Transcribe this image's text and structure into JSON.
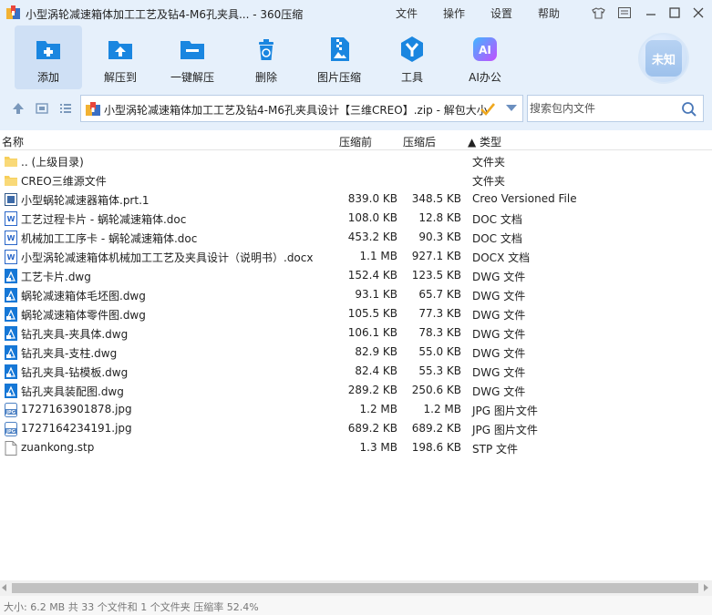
{
  "window": {
    "title": "小型涡轮减速箱体加工工艺及钻4-M6孔夹具... - 360压缩",
    "menu": [
      "文件",
      "操作",
      "设置",
      "帮助"
    ]
  },
  "toolbar": [
    {
      "label": "添加",
      "icon": "add-icon"
    },
    {
      "label": "解压到",
      "icon": "extract-to-icon"
    },
    {
      "label": "一键解压",
      "icon": "one-click-extract-icon"
    },
    {
      "label": "删除",
      "icon": "delete-icon"
    },
    {
      "label": "图片压缩",
      "icon": "image-compress-icon"
    },
    {
      "label": "工具",
      "icon": "tools-icon"
    },
    {
      "label": "AI办公",
      "icon": "ai-office-icon"
    }
  ],
  "badge": {
    "label": "未知"
  },
  "address": {
    "path": "小型涡轮减速箱体加工工艺及钻4-M6孔夹具设计【三维CREO】.zip - 解包大小"
  },
  "search": {
    "placeholder": "搜索包内文件"
  },
  "columns": {
    "name": "名称",
    "size": "压缩前",
    "packed": "压缩后",
    "type": "▲ 类型"
  },
  "files": [
    {
      "name": ".. (上级目录)",
      "size": "",
      "packed": "",
      "type": "文件夹",
      "icon": "folder-icon"
    },
    {
      "name": "CREO三维源文件",
      "size": "",
      "packed": "",
      "type": "文件夹",
      "icon": "folder-icon"
    },
    {
      "name": "小型蜗轮减速器箱体.prt.1",
      "size": "839.0 KB",
      "packed": "348.5 KB",
      "type": "Creo Versioned File",
      "icon": "creo-file-icon"
    },
    {
      "name": "工艺过程卡片 - 蜗轮减速箱体.doc",
      "size": "108.0 KB",
      "packed": "12.8 KB",
      "type": "DOC 文档",
      "icon": "word-doc-icon"
    },
    {
      "name": "机械加工工序卡 - 蜗轮减速箱体.doc",
      "size": "453.2 KB",
      "packed": "90.3 KB",
      "type": "DOC 文档",
      "icon": "word-doc-icon"
    },
    {
      "name": "小型涡轮减速箱体机械加工工艺及夹具设计（说明书）.docx",
      "size": "1.1 MB",
      "packed": "927.1 KB",
      "type": "DOCX 文档",
      "icon": "word-doc-icon"
    },
    {
      "name": "工艺卡片.dwg",
      "size": "152.4 KB",
      "packed": "123.5 KB",
      "type": "DWG 文件",
      "icon": "dwg-file-icon"
    },
    {
      "name": "蜗轮减速箱体毛坯图.dwg",
      "size": "93.1 KB",
      "packed": "65.7 KB",
      "type": "DWG 文件",
      "icon": "dwg-file-icon"
    },
    {
      "name": "蜗轮减速箱体零件图.dwg",
      "size": "105.5 KB",
      "packed": "77.3 KB",
      "type": "DWG 文件",
      "icon": "dwg-file-icon"
    },
    {
      "name": "钻孔夹具-夹具体.dwg",
      "size": "106.1 KB",
      "packed": "78.3 KB",
      "type": "DWG 文件",
      "icon": "dwg-file-icon"
    },
    {
      "name": "钻孔夹具-支柱.dwg",
      "size": "82.9 KB",
      "packed": "55.0 KB",
      "type": "DWG 文件",
      "icon": "dwg-file-icon"
    },
    {
      "name": "钻孔夹具-钻模板.dwg",
      "size": "82.4 KB",
      "packed": "55.3 KB",
      "type": "DWG 文件",
      "icon": "dwg-file-icon"
    },
    {
      "name": "钻孔夹具装配图.dwg",
      "size": "289.2 KB",
      "packed": "250.6 KB",
      "type": "DWG 文件",
      "icon": "dwg-file-icon"
    },
    {
      "name": "1727163901878.jpg",
      "size": "1.2 MB",
      "packed": "1.2 MB",
      "type": "JPG 图片文件",
      "icon": "jpg-file-icon"
    },
    {
      "name": "1727164234191.jpg",
      "size": "689.2 KB",
      "packed": "689.2 KB",
      "type": "JPG 图片文件",
      "icon": "jpg-file-icon"
    },
    {
      "name": "zuankong.stp",
      "size": "1.3 MB",
      "packed": "198.6 KB",
      "type": "STP 文件",
      "icon": "generic-file-icon"
    }
  ],
  "status": {
    "text": "大小: 6.2 MB 共 33 个文件和 1 个文件夹 压缩率 52.4%"
  }
}
